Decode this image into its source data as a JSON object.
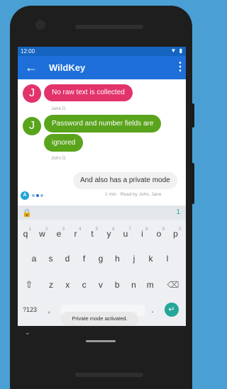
{
  "status_bar": {
    "time": "12:00",
    "icons": [
      "wifi-icon",
      "battery-icon"
    ]
  },
  "app_bar": {
    "title": "WildKey",
    "back_icon": "←",
    "menu_icon": "⋮"
  },
  "messages": [
    {
      "avatar": "J",
      "text": "No raw text is collected",
      "sender": "Jane D",
      "color": "#e2336b"
    },
    {
      "avatar": "J",
      "text_lines": [
        "Password and number fields are",
        "ignored"
      ],
      "sender": "John D",
      "color": "#5aa41c"
    }
  ],
  "my_message": {
    "text": "And also has a private mode",
    "meta": "1 min · Read by John, Jane"
  },
  "typing": {
    "avatar": "A"
  },
  "keyboard": {
    "lock_icon": "🔒",
    "suggestion": "1",
    "row1": [
      "q",
      "w",
      "e",
      "r",
      "t",
      "y",
      "u",
      "i",
      "o",
      "p"
    ],
    "row1_hints": [
      "1",
      "2",
      "3",
      "4",
      "5",
      "6",
      "7",
      "8",
      "9",
      "0"
    ],
    "row2": [
      "a",
      "s",
      "d",
      "f",
      "g",
      "h",
      "j",
      "k",
      "l"
    ],
    "row3": [
      "z",
      "x",
      "c",
      "v",
      "b",
      "n",
      "m"
    ],
    "shift_icon": "⇧",
    "backspace_icon": "⌫",
    "symbols_label": "?123",
    "comma": ",",
    "period": ".",
    "enter_icon": "↵",
    "toast": "Private mode activated."
  },
  "nav": {
    "chevron": "⌄"
  },
  "colors": {
    "brand": "#1e6fd9",
    "status": "#1565c0",
    "accent": "#26a69a"
  }
}
